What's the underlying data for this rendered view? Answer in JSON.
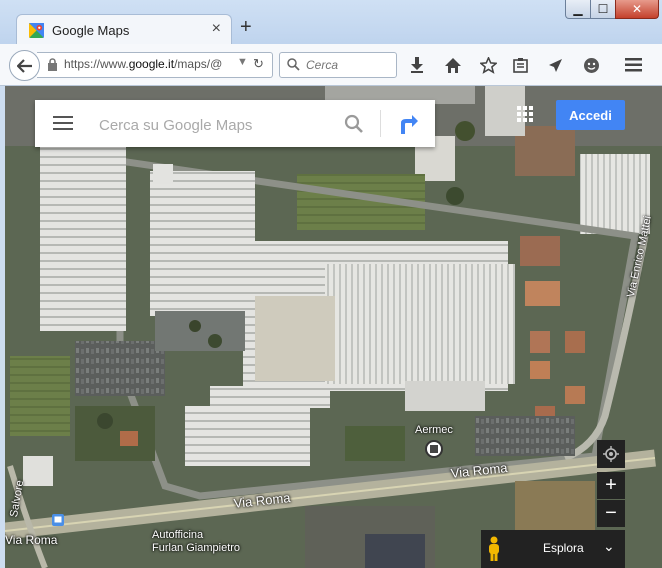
{
  "browser": {
    "tab_title": "Google Maps",
    "url_prefix": "https://www.",
    "url_domain": "google.it",
    "url_path": "/maps/@",
    "search_placeholder": "Cerca"
  },
  "maps": {
    "search_placeholder": "Cerca su Google Maps",
    "signin_label": "Accedi",
    "explore_label": "Esplora",
    "zoom_in_label": "+",
    "zoom_out_label": "−"
  },
  "map_labels": {
    "place_name": "Aermec",
    "business_line1": "Autofficina",
    "business_line2": "Furlan Giampietro",
    "street_roma_main": "Via Roma",
    "street_roma_left": "Via Roma",
    "street_mattei": "Via Enrico Mattei",
    "street_left_partial": "Via Roma",
    "street_left_vertical": "Salvore"
  },
  "colors": {
    "accent": "#4285f4",
    "directions": "#4285f4"
  }
}
